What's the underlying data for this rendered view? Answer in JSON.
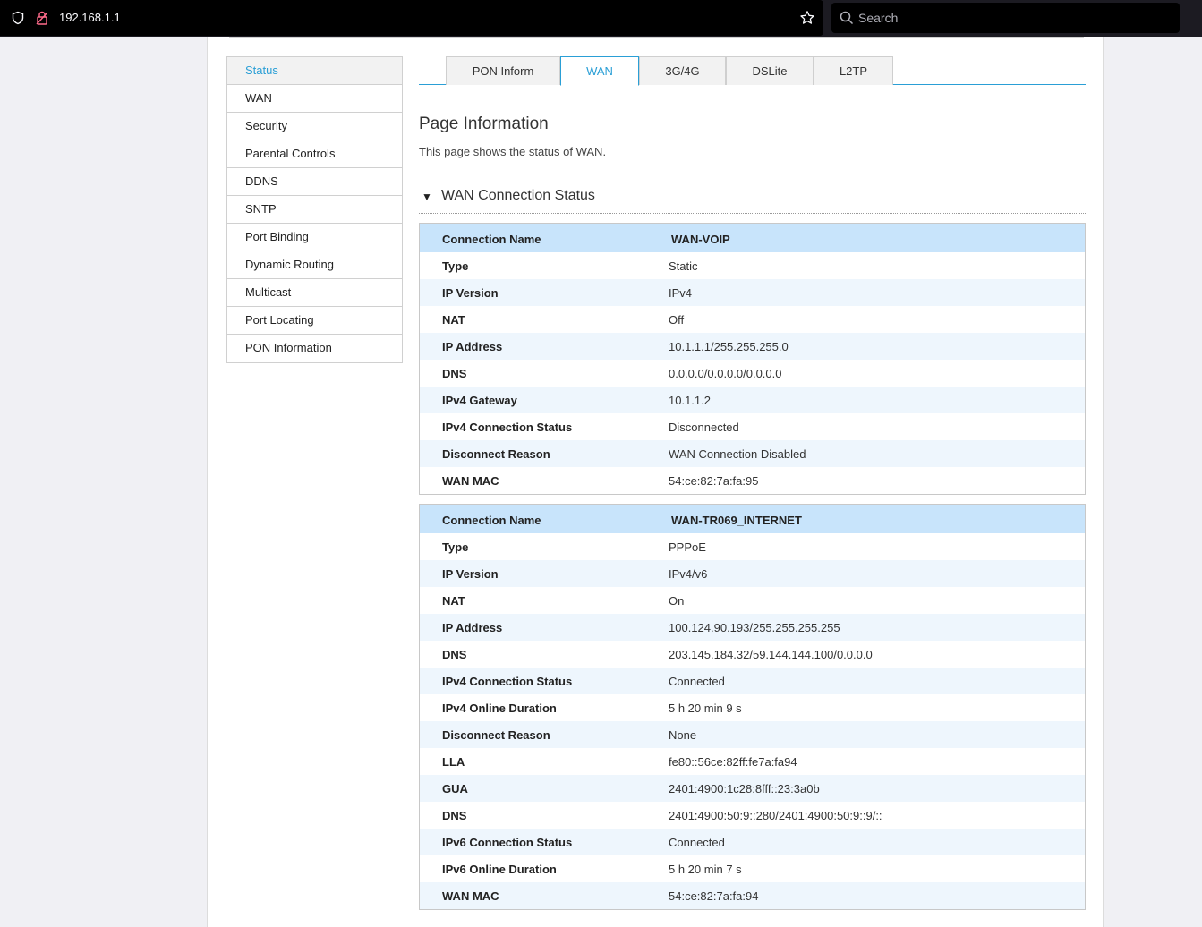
{
  "browser": {
    "url": "192.168.1.1",
    "search_placeholder": "Search"
  },
  "sidebar": {
    "items": [
      {
        "label": "Status",
        "active": true
      },
      {
        "label": "WAN"
      },
      {
        "label": "Security"
      },
      {
        "label": "Parental Controls"
      },
      {
        "label": "DDNS"
      },
      {
        "label": "SNTP"
      },
      {
        "label": "Port Binding"
      },
      {
        "label": "Dynamic Routing"
      },
      {
        "label": "Multicast"
      },
      {
        "label": "Port Locating"
      },
      {
        "label": "PON Information"
      }
    ]
  },
  "tabs": [
    {
      "label": "PON Inform"
    },
    {
      "label": "WAN",
      "active": true
    },
    {
      "label": "3G/4G"
    },
    {
      "label": "DSLite"
    },
    {
      "label": "L2TP"
    }
  ],
  "page": {
    "title": "Page Information",
    "description": "This page shows the status of WAN."
  },
  "section": {
    "title": "WAN Connection Status"
  },
  "connections": [
    {
      "rows": [
        {
          "label": "Connection Name",
          "value": "WAN-VOIP"
        },
        {
          "label": "Type",
          "value": "Static"
        },
        {
          "label": "IP Version",
          "value": "IPv4"
        },
        {
          "label": "NAT",
          "value": "Off"
        },
        {
          "label": "IP Address",
          "value": "10.1.1.1/255.255.255.0"
        },
        {
          "label": "DNS",
          "value": "0.0.0.0/0.0.0.0/0.0.0.0"
        },
        {
          "label": "IPv4 Gateway",
          "value": "10.1.1.2"
        },
        {
          "label": "IPv4 Connection Status",
          "value": "Disconnected"
        },
        {
          "label": "Disconnect Reason",
          "value": "WAN Connection Disabled"
        },
        {
          "label": "WAN MAC",
          "value": "54:ce:82:7a:fa:95"
        }
      ]
    },
    {
      "rows": [
        {
          "label": "Connection Name",
          "value": "WAN-TR069_INTERNET"
        },
        {
          "label": "Type",
          "value": "PPPoE"
        },
        {
          "label": "IP Version",
          "value": "IPv4/v6"
        },
        {
          "label": "NAT",
          "value": "On"
        },
        {
          "label": "IP Address",
          "value": "100.124.90.193/255.255.255.255"
        },
        {
          "label": "DNS",
          "value": "203.145.184.32/59.144.144.100/0.0.0.0"
        },
        {
          "label": "IPv4 Connection Status",
          "value": "Connected"
        },
        {
          "label": "IPv4 Online Duration",
          "value": "5 h 20 min 9 s"
        },
        {
          "label": "Disconnect Reason",
          "value": "None"
        },
        {
          "label": "LLA",
          "value": "fe80::56ce:82ff:fe7a:fa94"
        },
        {
          "label": "GUA",
          "value": "2401:4900:1c28:8fff::23:3a0b"
        },
        {
          "label": "DNS",
          "value": "2401:4900:50:9::280/2401:4900:50:9::9/::"
        },
        {
          "label": "IPv6 Connection Status",
          "value": "Connected"
        },
        {
          "label": "IPv6 Online Duration",
          "value": "5 h 20 min 7 s"
        },
        {
          "label": "WAN MAC",
          "value": "54:ce:82:7a:fa:94"
        }
      ]
    }
  ],
  "colors": {
    "accent": "#2a9fd6",
    "header_row": "#c8e4fb",
    "alt_row": "#eef6fd"
  }
}
